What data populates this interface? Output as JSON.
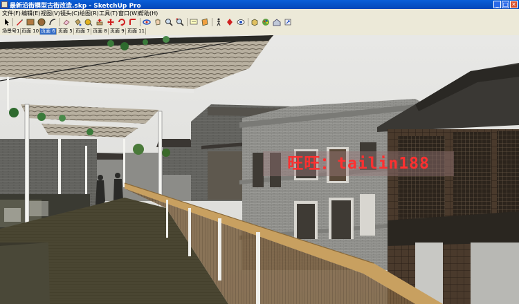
{
  "window": {
    "title": "最新沿街模型古街改造.skp - SketchUp Pro",
    "minimize_glyph": "_",
    "maximize_glyph": "□",
    "close_glyph": "✕"
  },
  "menu": {
    "items": [
      {
        "label": "文件(F)"
      },
      {
        "label": "编辑(E)"
      },
      {
        "label": "视图(V)"
      },
      {
        "label": "镜头(C)"
      },
      {
        "label": "绘图(R)"
      },
      {
        "label": "工具(T)"
      },
      {
        "label": "窗口(W)"
      },
      {
        "label": "帮助(H)"
      }
    ]
  },
  "toolbar": {
    "tools": [
      {
        "icon": "select-arrow-icon"
      },
      {
        "icon": "pencil-line-icon"
      },
      {
        "icon": "rectangle-icon"
      },
      {
        "icon": "circle-icon"
      },
      {
        "icon": "arc-icon"
      },
      {
        "icon": "eraser-icon"
      },
      {
        "icon": "paint-bucket-icon"
      },
      {
        "icon": "tape-measure-icon"
      },
      {
        "icon": "push-pull-icon"
      },
      {
        "icon": "move-icon"
      },
      {
        "icon": "rotate-icon"
      },
      {
        "icon": "follow-me-icon"
      },
      {
        "icon": "orbit-icon"
      },
      {
        "icon": "pan-icon"
      },
      {
        "icon": "zoom-icon"
      },
      {
        "icon": "zoom-extents-icon"
      },
      {
        "icon": "text-icon"
      },
      {
        "icon": "section-plane-icon"
      },
      {
        "icon": "walk-icon"
      },
      {
        "icon": "position-camera-icon"
      },
      {
        "icon": "look-around-icon"
      },
      {
        "icon": "components-icon"
      },
      {
        "icon": "materials-icon"
      },
      {
        "icon": "warehouse-icon"
      },
      {
        "icon": "share-model-icon"
      }
    ]
  },
  "scene_tabs": [
    {
      "label": "场景号1",
      "active": false
    },
    {
      "label": "页面 10",
      "active": false
    },
    {
      "label": "页面 6",
      "active": true
    },
    {
      "label": "页面 5",
      "active": false
    },
    {
      "label": "页面 7",
      "active": false
    },
    {
      "label": "页面 8",
      "active": false
    },
    {
      "label": "页面 9",
      "active": false
    },
    {
      "label": "页面 11",
      "active": false
    }
  ],
  "viewport": {
    "watermark": "旺旺：tailin188"
  },
  "colors": {
    "sky": "#e6e6e3",
    "titlebar": "#0a5fd8",
    "watermark_text": "#ff3030",
    "handrail": "#c8a060"
  }
}
